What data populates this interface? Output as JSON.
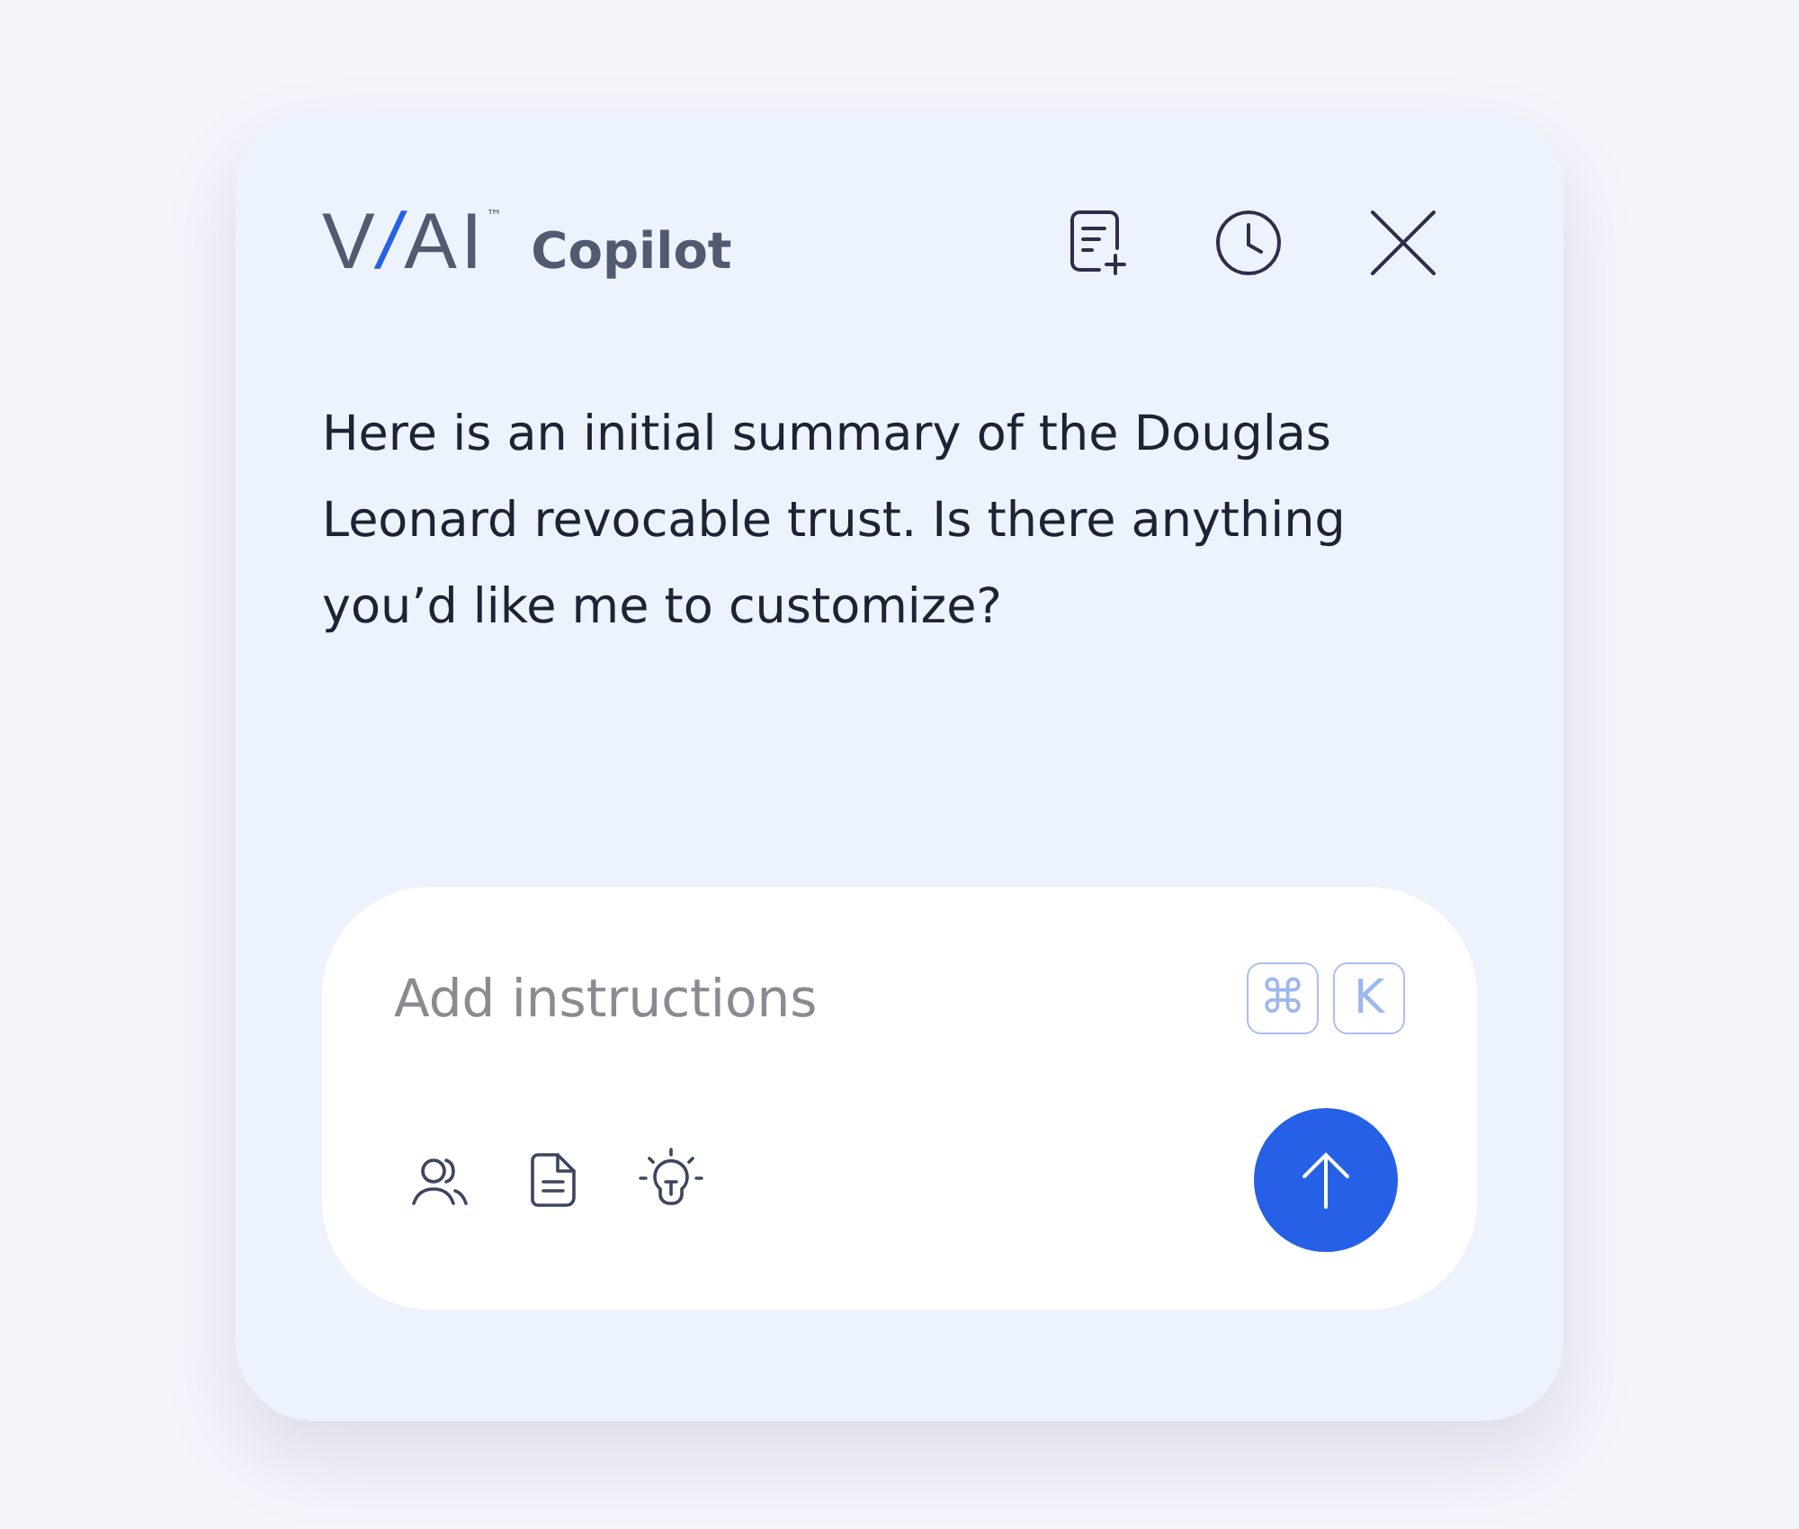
{
  "header": {
    "logo": {
      "parts": [
        {
          "text": "V",
          "accent": false
        },
        {
          "text": "/",
          "accent": true
        },
        {
          "text": "AI",
          "accent": false
        }
      ],
      "trademark": "™"
    },
    "title": "Copilot"
  },
  "message": "Here is an initial summary of the Douglas Leonard revocable trust. Is there anything you’d like me to customize?",
  "composer": {
    "placeholder": "Add instructions",
    "shortcut": [
      "⌘",
      "K"
    ]
  }
}
